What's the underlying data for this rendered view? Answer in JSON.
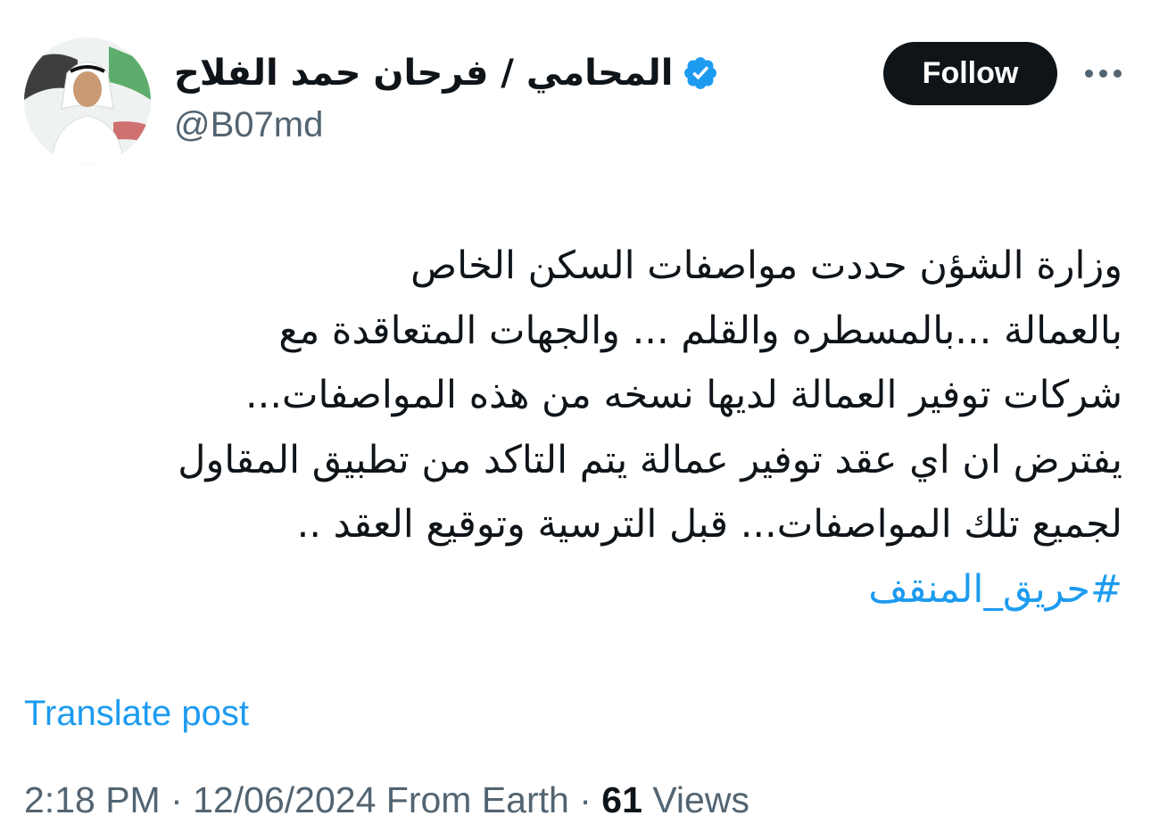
{
  "author": {
    "display_name": "المحامي / فرحان حمد الفلاح",
    "handle": "@B07md",
    "verified": true
  },
  "actions": {
    "follow_label": "Follow",
    "more_icon": "more-horizontal-icon"
  },
  "tweet": {
    "lines": [
      "وزارة الشؤن حددت مواصفات السكن الخاص",
      "بالعمالة ...بالمسطره والقلم ... والجهات  المتعاقدة مع",
      "شركات توفير العمالة لديها نسخه من هذه المواصفات...",
      "يفترض ان اي عقد توفير عمالة يتم التاكد من تطبيق المقاول",
      "لجميع تلك المواصفات... قبل الترسية وتوقيع العقد .."
    ],
    "hashtag": "#حريق_المنقف"
  },
  "translate_label": "Translate post",
  "meta": {
    "time": "2:18 PM",
    "date": "12/06/2024",
    "source": "From Earth",
    "separator": "·",
    "views_count": "61",
    "views_label": "Views"
  },
  "colors": {
    "text": "#0f1419",
    "secondary": "#536471",
    "accent": "#1d9bf0",
    "button_bg": "#0f1419",
    "button_text": "#ffffff"
  }
}
